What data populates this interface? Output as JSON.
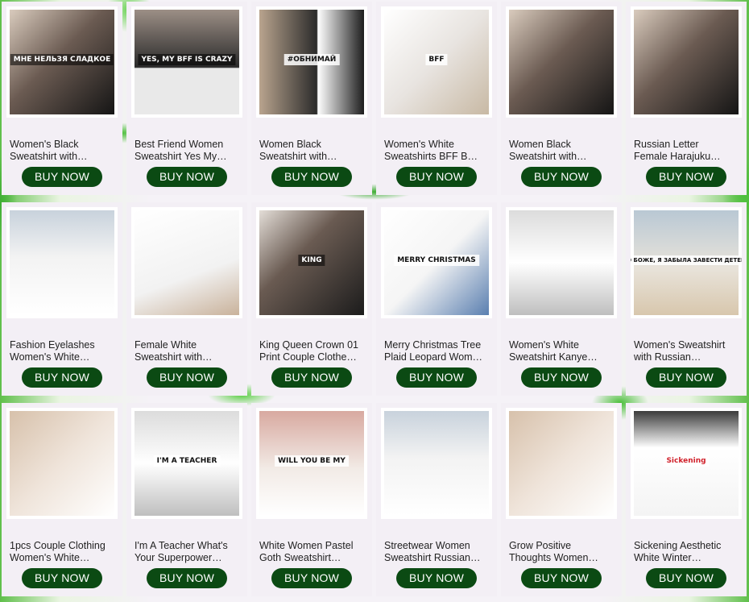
{
  "products": [
    {
      "title_line1": "Women's Black",
      "title_line2": "Sweatshirt with…",
      "button": "BUY NOW",
      "print": "МНЕ НЕЛЬЗЯ СЛАДКОЕ",
      "style": "dark"
    },
    {
      "title_line1": "Best Friend Women",
      "title_line2": "Sweatshirt Yes My…",
      "button": "BUY NOW",
      "print": "YES, MY BFF IS CRAZY",
      "style": "dark2"
    },
    {
      "title_line1": "Women Black",
      "title_line2": "Sweatshirt with…",
      "button": "BUY NOW",
      "print": "#ОБНИМАЙ",
      "style": "dark3"
    },
    {
      "title_line1": "Women's White",
      "title_line2": "Sweatshirts BFF B…",
      "button": "BUY NOW",
      "print": "BFF",
      "style": "white1"
    },
    {
      "title_line1": "Women Black",
      "title_line2": "Sweatshirt with…",
      "button": "BUY NOW",
      "print": "",
      "style": "dark"
    },
    {
      "title_line1": "Russian Letter",
      "title_line2": "Female Harajuku…",
      "button": "BUY NOW",
      "print": "",
      "style": "dark"
    },
    {
      "title_line1": "Fashion Eyelashes",
      "title_line2": "Women's White…",
      "button": "BUY NOW",
      "print": "",
      "style": "white2"
    },
    {
      "title_line1": "Female White",
      "title_line2": "Sweatshirt with…",
      "button": "BUY NOW",
      "print": "",
      "style": "white3"
    },
    {
      "title_line1": "King Queen Crown 01",
      "title_line2": "Print Couple Clothe…",
      "button": "BUY NOW",
      "print": "KING",
      "style": "couple"
    },
    {
      "title_line1": "Merry Christmas Tree",
      "title_line2": "Plaid Leopard Wom…",
      "button": "BUY NOW",
      "print": "MERRY CHRISTMAS",
      "style": "xmas"
    },
    {
      "title_line1": "Women's White",
      "title_line2": "Sweatshirt Kanye…",
      "button": "BUY NOW",
      "print": "",
      "style": "grey"
    },
    {
      "title_line1": "Women's Sweatshirt",
      "title_line2": "with Russian…",
      "button": "BUY NOW",
      "print": "О БОЖЕ, Я ЗАБЫЛА ЗАВЕСТИ ДЕТЕЙ",
      "style": "beach"
    },
    {
      "title_line1": "1pcs Couple Clothing",
      "title_line2": "Women's White…",
      "button": "BUY NOW",
      "print": "",
      "style": "warm"
    },
    {
      "title_line1": "I'm A Teacher What's",
      "title_line2": "Your Superpower…",
      "button": "BUY NOW",
      "print": "I'M A TEACHER",
      "style": "grey"
    },
    {
      "title_line1": "White Women Pastel",
      "title_line2": "Goth Sweatshirt…",
      "button": "BUY NOW",
      "print": "WILL YOU BE MY",
      "style": "pink"
    },
    {
      "title_line1": "Streetwear Women",
      "title_line2": "Sweatshirt Russian…",
      "button": "BUY NOW",
      "print": "",
      "style": "white2"
    },
    {
      "title_line1": "Grow Positive",
      "title_line2": "Thoughts Women…",
      "button": "BUY NOW",
      "print": "",
      "style": "warm"
    },
    {
      "title_line1": "Sickening Aesthetic",
      "title_line2": "White Winter…",
      "button": "BUY NOW",
      "print": "Sickening",
      "style": "red"
    }
  ],
  "colors": {
    "button_bg": "#0b4a13",
    "button_text": "#ffffff",
    "card_bg": "#f3eff5",
    "accent_leaf": "#4bbf3a"
  }
}
